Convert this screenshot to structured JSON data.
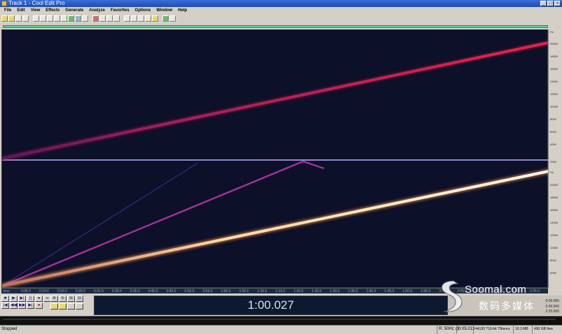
{
  "window": {
    "title": "Track 1 - Cool Edit Pro",
    "buttons": [
      "_",
      "□",
      "×"
    ]
  },
  "menu": [
    "File",
    "Edit",
    "View",
    "Effects",
    "Generate",
    "Analyze",
    "Favorites",
    "Options",
    "Window",
    "Help"
  ],
  "timeline_ticks": [
    "hms",
    "0:05.0",
    "0:10.0",
    "0:15.0",
    "0:20.0",
    "0:25.0",
    "0:30.0",
    "0:35.0",
    "0:40.0",
    "0:45.0",
    "0:50.0",
    "0:55.0",
    "1:00.0",
    "1:05.0",
    "1:10.0",
    "1:15.0",
    "1:20.0",
    "1:25.0",
    "1:30.0",
    "1:35.0",
    "1:40.0",
    "1:45.0",
    "1:50.0",
    "1:55.0",
    "2:00.0",
    "2:05.0",
    "2:10.0",
    "2:15.0",
    "2:20.0",
    "2:25.0"
  ],
  "freq_ruler": [
    "Hz",
    "20000",
    "18000",
    "16000",
    "14000",
    "12000",
    "10000",
    "8000",
    "6000",
    "4000",
    "2000",
    "Hz",
    "20000",
    "18000",
    "16000",
    "14000",
    "12000",
    "10000",
    "8000",
    "6000",
    "4000",
    "2000"
  ],
  "transport": {
    "row1": [
      "■",
      "▶",
      "▶|",
      "||",
      "●",
      "∞"
    ],
    "row2": [
      "|◀",
      "◀◀",
      "▶▶",
      "▶|",
      "●"
    ],
    "zoom": [
      "⊕",
      "⊖",
      "⊞",
      "⊟"
    ]
  },
  "time_display": "1:00.027",
  "selection": {
    "begin": "0:00.000",
    "end": "0:00.000",
    "length": "2:25.000"
  },
  "status": {
    "state": "Stopped",
    "cells": [
      "R: 50Hz @",
      "0:05.013",
      "44100 ?16-bit ?Stereo",
      "10.3 MB",
      "400 GB free"
    ]
  },
  "watermark": {
    "brand": "Soomal.com",
    "chinese": "数码多媒体"
  },
  "colors": {
    "background": "#0c1028",
    "upper_sweep": "#e0204a",
    "lower_main": "#fff0d8",
    "lower_secondary": "#a0309a",
    "lower_faint": "#3a2880",
    "divider": "#c0b0ff"
  }
}
